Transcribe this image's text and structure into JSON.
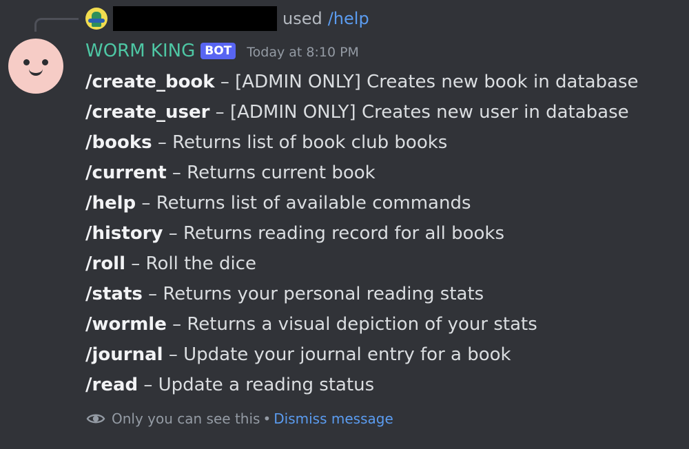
{
  "reply": {
    "username_redacted": "",
    "used_text": "used",
    "command": "/help"
  },
  "message": {
    "author": "WORM KING",
    "bot_tag": "BOT",
    "timestamp": "Today at 8:10 PM"
  },
  "commands": [
    {
      "name": "/create_book",
      "separator": " – ",
      "description": "[ADMIN ONLY] Creates new book in database"
    },
    {
      "name": "/create_user",
      "separator": " – ",
      "description": "[ADMIN ONLY] Creates new user in database"
    },
    {
      "name": "/books",
      "separator": " – ",
      "description": "Returns list of book club books"
    },
    {
      "name": "/current",
      "separator": " – ",
      "description": "Returns current book"
    },
    {
      "name": "/help",
      "separator": " – ",
      "description": "Returns list of available commands"
    },
    {
      "name": "/history",
      "separator": " – ",
      "description": "Returns reading record for all books"
    },
    {
      "name": "/roll",
      "separator": " – ",
      "description": "Roll the dice"
    },
    {
      "name": "/stats",
      "separator": " – ",
      "description": "Returns your personal reading stats"
    },
    {
      "name": "/wormle",
      "separator": " – ",
      "description": "Returns a visual depiction of your stats"
    },
    {
      "name": "/journal",
      "separator": " – ",
      "description": "Update your journal entry for a book"
    },
    {
      "name": "/read",
      "separator": " – ",
      "description": "Update a reading status"
    }
  ],
  "ephemeral": {
    "notice": "Only you can see this",
    "dot": "•",
    "dismiss_label": "Dismiss message"
  },
  "icons": {
    "eye": "eye-icon"
  },
  "colors": {
    "background": "#313338",
    "author": "#4ec7a4",
    "bot_tag": "#5865f2",
    "link": "#5b9cf0",
    "muted": "#949ba4"
  }
}
